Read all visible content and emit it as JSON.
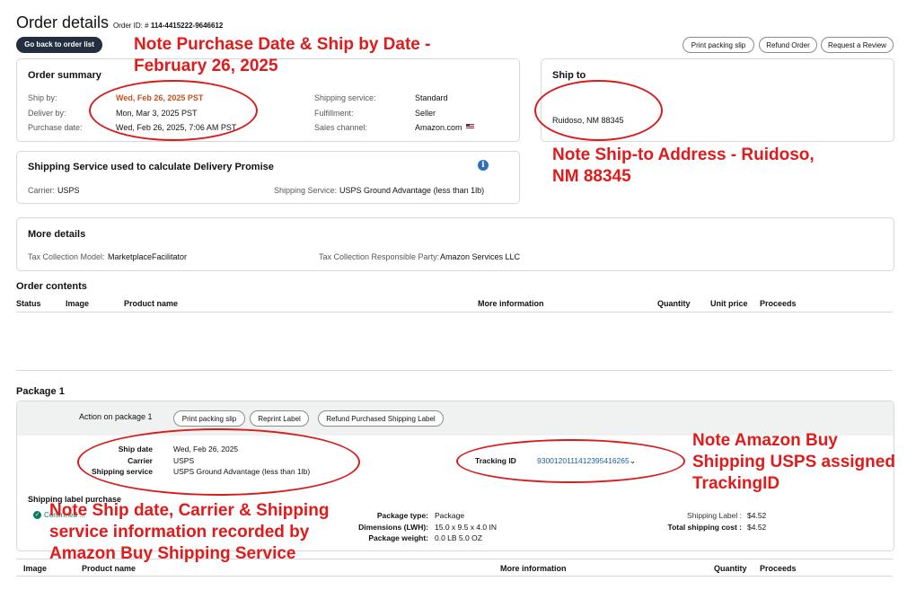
{
  "header": {
    "title": "Order details",
    "order_id_label": "Order ID: #",
    "order_id": "114-4415222-9646612",
    "back_button": "Go back to order list",
    "print_packing_slip": "Print packing slip",
    "refund_order": "Refund Order",
    "request_review": "Request a Review"
  },
  "order_summary": {
    "title": "Order summary",
    "ship_by_label": "Ship by:",
    "ship_by": "Wed, Feb 26, 2025 PST",
    "deliver_by_label": "Deliver by:",
    "deliver_by": "Mon, Mar 3, 2025 PST",
    "purchase_date_label": "Purchase date:",
    "purchase_date": "Wed, Feb 26, 2025, 7:06 AM PST",
    "shipping_service_label": "Shipping service:",
    "shipping_service": "Standard",
    "fulfillment_label": "Fulfillment:",
    "fulfillment": "Seller",
    "sales_channel_label": "Sales channel:",
    "sales_channel": "Amazon.com",
    "accent_color": "#c7511f"
  },
  "ship_to": {
    "title": "Ship to",
    "address": "Ruidoso, NM 88345"
  },
  "shipping_service_card": {
    "title": "Shipping Service used to calculate Delivery Promise",
    "carrier_label": "Carrier:",
    "carrier": "USPS",
    "service_label": "Shipping Service:",
    "service": "USPS Ground Advantage (less than 1lb)"
  },
  "more_details": {
    "title": "More details",
    "tax_model_label": "Tax Collection Model:",
    "tax_model": "MarketplaceFacilitator",
    "tax_party_label": "Tax Collection Responsible Party:",
    "tax_party": "Amazon Services LLC"
  },
  "order_contents": {
    "title": "Order contents",
    "columns": [
      "Status",
      "Image",
      "Product name",
      "More information",
      "Quantity",
      "Unit price",
      "Proceeds"
    ]
  },
  "package": {
    "title": "Package 1",
    "action_label": "Action on package 1",
    "print_packing_slip": "Print packing slip",
    "reprint_label": "Reprint Label",
    "refund_label": "Refund Purchased Shipping Label",
    "ship_date_label": "Ship date",
    "ship_date": "Wed, Feb 26, 2025",
    "carrier_label": "Carrier",
    "carrier": "USPS",
    "service_label": "Shipping service",
    "service": "USPS Ground Advantage (less than 1lb)",
    "tracking_label": "Tracking ID",
    "tracking_id": "9300120111412395416265",
    "label_purchase_title": "Shipping label purchase",
    "label_status": "Confirmed ... ",
    "package_type_label": "Package type:",
    "package_type": "Package",
    "dimensions_label": "Dimensions (LWH):",
    "dimensions": "15.0 x 9.5 x 4.0 IN",
    "weight_label": "Package weight:",
    "weight": "0.0 LB 5.0 OZ",
    "shipping_label_label": "Shipping Label :",
    "shipping_label_cost": "$4.52",
    "total_label": "Total shipping cost :",
    "total_cost": "$4.52"
  },
  "package_contents": {
    "columns": [
      "Image",
      "Product name",
      "More information",
      "Quantity",
      "Proceeds"
    ]
  },
  "annotations": {
    "purchase_note_1": "Note Purchase Date & Ship by Date -",
    "purchase_note_2": "February 26, 2025",
    "shipto_note_1": "Note Ship-to Address - Ruidoso,",
    "shipto_note_2": "NM 88345",
    "tracking_note_1": "Note Amazon Buy",
    "tracking_note_2": "Shipping USPS assigned",
    "tracking_note_3": "TrackingID",
    "shipdate_note_1": "Note Ship date, Carrier & Shipping",
    "shipdate_note_2": "service information recorded by",
    "shipdate_note_3": "Amazon Buy Shipping Service",
    "color": "#e01b1b"
  }
}
